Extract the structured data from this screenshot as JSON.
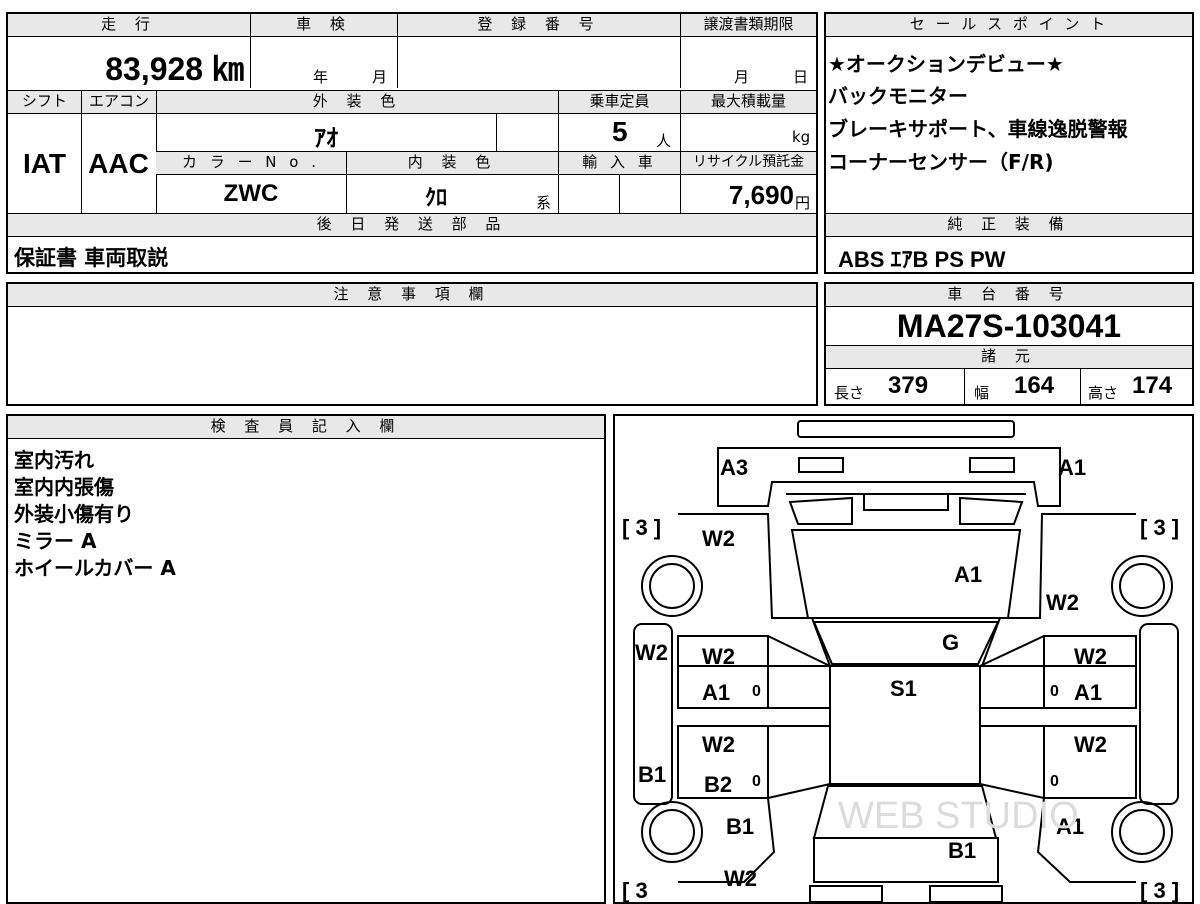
{
  "headers": {
    "mileage": "走 行",
    "inspection": "車 検",
    "registration_no": "登 録 番 号",
    "transfer_deadline": "譲渡書類期限",
    "sales_points": "セ ー ル ス ポ イ ン ト",
    "shift": "シフト",
    "aircon": "エアコン",
    "exterior_color": "外 装 色",
    "capacity": "乗車定員",
    "max_load": "最大積載量",
    "color_no": "カ ラ ー N o .",
    "interior_color": "内 装 色",
    "import": "輸 入 車",
    "recycle_fee": "リサイクル預託金",
    "later_parts": "後 日 発 送 部 品",
    "genuine_equipment": "純 正 装 備",
    "notes": "注 意 事 項 欄",
    "chassis_no": "車 台 番 号",
    "specs": "諸 元",
    "inspector": "検 査 員 記 入 欄"
  },
  "vehicle": {
    "mileage": "83,928 ㎞",
    "inspection_year": "年",
    "inspection_month": "月",
    "deadline_month": "月",
    "deadline_day": "日",
    "shift": "IAT",
    "aircon": "AAC",
    "exterior_color": "ｱｵ",
    "capacity": "5",
    "capacity_unit": "人",
    "max_load_unit": "kg",
    "color_no": "ZWC",
    "interior_color": "ｸﾛ",
    "interior_suffix": "系",
    "recycle_fee": "7,690",
    "recycle_unit": "円",
    "later_parts": "保証書 車両取説",
    "genuine_equipment": "ABS ｴｱB PS PW",
    "chassis_no": "MA27S-103041",
    "length_label": "長さ",
    "length": "379",
    "width_label": "幅",
    "width": "164",
    "height_label": "高さ",
    "height": "174"
  },
  "sales_points": [
    "★オークションデビュー★",
    "バックモニター",
    "ブレーキサポート、車線逸脱警報",
    "コーナーセンサー（F/R)"
  ],
  "inspector_notes": [
    "室内汚れ",
    "室内内張傷",
    "外装小傷有り",
    "ミラー A",
    "ホイールカバー A"
  ],
  "diagram": {
    "tire_tl": "[ 3 ]",
    "tire_tr": "[ 3 ]",
    "tire_bl": "[ 3",
    "tire_br": "[ 3 ]",
    "front_left_corner": "A3",
    "front_right_corner": "A1",
    "left_fender": "W2",
    "hood": "A1",
    "right_fender": "W2",
    "windshield": "G",
    "left_step": "W2",
    "front_left_door_top": "W2",
    "front_left_door_bottom": "A1",
    "roof": "S1",
    "front_right_door_top": "W2",
    "front_right_door_bottom": "A1",
    "rear_left_door_top": "W2",
    "rear_left_door_bottom": "B2",
    "left_rocker": "B1",
    "rear_right_door_top": "W2",
    "rear_left_quarter": "B1",
    "rear_right_quarter": "A1",
    "rear_hatch": "B1",
    "rear_left_lower": "W2",
    "mark_0": "0",
    "watermark": "WEB STUDIO"
  }
}
